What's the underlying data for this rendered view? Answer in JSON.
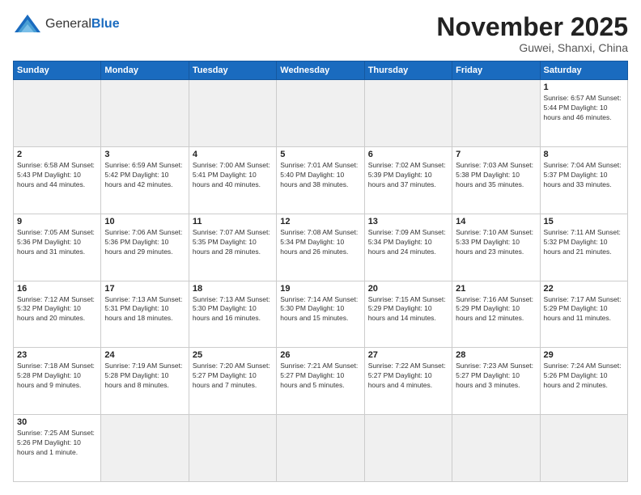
{
  "header": {
    "logo_general": "General",
    "logo_blue": "Blue",
    "month_title": "November 2025",
    "location": "Guwei, Shanxi, China"
  },
  "weekdays": [
    "Sunday",
    "Monday",
    "Tuesday",
    "Wednesday",
    "Thursday",
    "Friday",
    "Saturday"
  ],
  "weeks": [
    [
      {
        "day": "",
        "info": ""
      },
      {
        "day": "",
        "info": ""
      },
      {
        "day": "",
        "info": ""
      },
      {
        "day": "",
        "info": ""
      },
      {
        "day": "",
        "info": ""
      },
      {
        "day": "",
        "info": ""
      },
      {
        "day": "1",
        "info": "Sunrise: 6:57 AM\nSunset: 5:44 PM\nDaylight: 10 hours\nand 46 minutes."
      }
    ],
    [
      {
        "day": "2",
        "info": "Sunrise: 6:58 AM\nSunset: 5:43 PM\nDaylight: 10 hours\nand 44 minutes."
      },
      {
        "day": "3",
        "info": "Sunrise: 6:59 AM\nSunset: 5:42 PM\nDaylight: 10 hours\nand 42 minutes."
      },
      {
        "day": "4",
        "info": "Sunrise: 7:00 AM\nSunset: 5:41 PM\nDaylight: 10 hours\nand 40 minutes."
      },
      {
        "day": "5",
        "info": "Sunrise: 7:01 AM\nSunset: 5:40 PM\nDaylight: 10 hours\nand 38 minutes."
      },
      {
        "day": "6",
        "info": "Sunrise: 7:02 AM\nSunset: 5:39 PM\nDaylight: 10 hours\nand 37 minutes."
      },
      {
        "day": "7",
        "info": "Sunrise: 7:03 AM\nSunset: 5:38 PM\nDaylight: 10 hours\nand 35 minutes."
      },
      {
        "day": "8",
        "info": "Sunrise: 7:04 AM\nSunset: 5:37 PM\nDaylight: 10 hours\nand 33 minutes."
      }
    ],
    [
      {
        "day": "9",
        "info": "Sunrise: 7:05 AM\nSunset: 5:36 PM\nDaylight: 10 hours\nand 31 minutes."
      },
      {
        "day": "10",
        "info": "Sunrise: 7:06 AM\nSunset: 5:36 PM\nDaylight: 10 hours\nand 29 minutes."
      },
      {
        "day": "11",
        "info": "Sunrise: 7:07 AM\nSunset: 5:35 PM\nDaylight: 10 hours\nand 28 minutes."
      },
      {
        "day": "12",
        "info": "Sunrise: 7:08 AM\nSunset: 5:34 PM\nDaylight: 10 hours\nand 26 minutes."
      },
      {
        "day": "13",
        "info": "Sunrise: 7:09 AM\nSunset: 5:34 PM\nDaylight: 10 hours\nand 24 minutes."
      },
      {
        "day": "14",
        "info": "Sunrise: 7:10 AM\nSunset: 5:33 PM\nDaylight: 10 hours\nand 23 minutes."
      },
      {
        "day": "15",
        "info": "Sunrise: 7:11 AM\nSunset: 5:32 PM\nDaylight: 10 hours\nand 21 minutes."
      }
    ],
    [
      {
        "day": "16",
        "info": "Sunrise: 7:12 AM\nSunset: 5:32 PM\nDaylight: 10 hours\nand 20 minutes."
      },
      {
        "day": "17",
        "info": "Sunrise: 7:13 AM\nSunset: 5:31 PM\nDaylight: 10 hours\nand 18 minutes."
      },
      {
        "day": "18",
        "info": "Sunrise: 7:13 AM\nSunset: 5:30 PM\nDaylight: 10 hours\nand 16 minutes."
      },
      {
        "day": "19",
        "info": "Sunrise: 7:14 AM\nSunset: 5:30 PM\nDaylight: 10 hours\nand 15 minutes."
      },
      {
        "day": "20",
        "info": "Sunrise: 7:15 AM\nSunset: 5:29 PM\nDaylight: 10 hours\nand 14 minutes."
      },
      {
        "day": "21",
        "info": "Sunrise: 7:16 AM\nSunset: 5:29 PM\nDaylight: 10 hours\nand 12 minutes."
      },
      {
        "day": "22",
        "info": "Sunrise: 7:17 AM\nSunset: 5:29 PM\nDaylight: 10 hours\nand 11 minutes."
      }
    ],
    [
      {
        "day": "23",
        "info": "Sunrise: 7:18 AM\nSunset: 5:28 PM\nDaylight: 10 hours\nand 9 minutes."
      },
      {
        "day": "24",
        "info": "Sunrise: 7:19 AM\nSunset: 5:28 PM\nDaylight: 10 hours\nand 8 minutes."
      },
      {
        "day": "25",
        "info": "Sunrise: 7:20 AM\nSunset: 5:27 PM\nDaylight: 10 hours\nand 7 minutes."
      },
      {
        "day": "26",
        "info": "Sunrise: 7:21 AM\nSunset: 5:27 PM\nDaylight: 10 hours\nand 5 minutes."
      },
      {
        "day": "27",
        "info": "Sunrise: 7:22 AM\nSunset: 5:27 PM\nDaylight: 10 hours\nand 4 minutes."
      },
      {
        "day": "28",
        "info": "Sunrise: 7:23 AM\nSunset: 5:27 PM\nDaylight: 10 hours\nand 3 minutes."
      },
      {
        "day": "29",
        "info": "Sunrise: 7:24 AM\nSunset: 5:26 PM\nDaylight: 10 hours\nand 2 minutes."
      }
    ],
    [
      {
        "day": "30",
        "info": "Sunrise: 7:25 AM\nSunset: 5:26 PM\nDaylight: 10 hours\nand 1 minute."
      },
      {
        "day": "",
        "info": ""
      },
      {
        "day": "",
        "info": ""
      },
      {
        "day": "",
        "info": ""
      },
      {
        "day": "",
        "info": ""
      },
      {
        "day": "",
        "info": ""
      },
      {
        "day": "",
        "info": ""
      }
    ]
  ]
}
